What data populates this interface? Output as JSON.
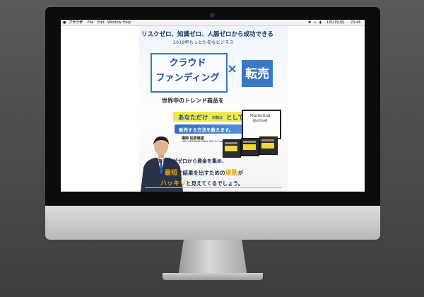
{
  "menubar": {
    "app_name": "ブラウザ",
    "menus": [
      "File",
      "Edit",
      "Window",
      "Help"
    ],
    "datetime": "1月2日(月)",
    "time": "23:48"
  },
  "page": {
    "headline": "リスクゼロ、知識ゼロ、人脈ゼロから成功できる",
    "subheadline": "2019年もっとも旬なビジネス",
    "crowdfunding_line1": "クラウド",
    "crowdfunding_line2": "ファンディング",
    "times_symbol": "×",
    "resale": "転売",
    "trend_text": "世界中のトレンド商品を",
    "anatadake": "あなただけ",
    "senzoku": "の独占",
    "toshite": "として",
    "teach_text": "販売する方法を教えます。",
    "board_line1": "Marketing",
    "board_line2": "method",
    "presenter_title": "講師",
    "presenter_name": "柏原徹雄",
    "presenter_en": "UNIT INTERNATIONAL CEO & Founder",
    "body_line1_a": "あなたがゼロから資金を集め、",
    "body_line2_hl1": "最短",
    "body_line2_b": "で結果を出すための",
    "body_line2_hl2": "道筋",
    "body_line2_c": "が",
    "body_line3_hl": "ハッキリ",
    "body_line3_b": "と見えてくるでしょう。"
  },
  "colors": {
    "accent_blue": "#3a78c6",
    "highlight_yellow": "#f1e94a",
    "highlight_orange": "#e4a10c"
  },
  "icons": {
    "apple": "apple-icon",
    "wifi": "wifi-icon",
    "battery": "battery-icon"
  }
}
